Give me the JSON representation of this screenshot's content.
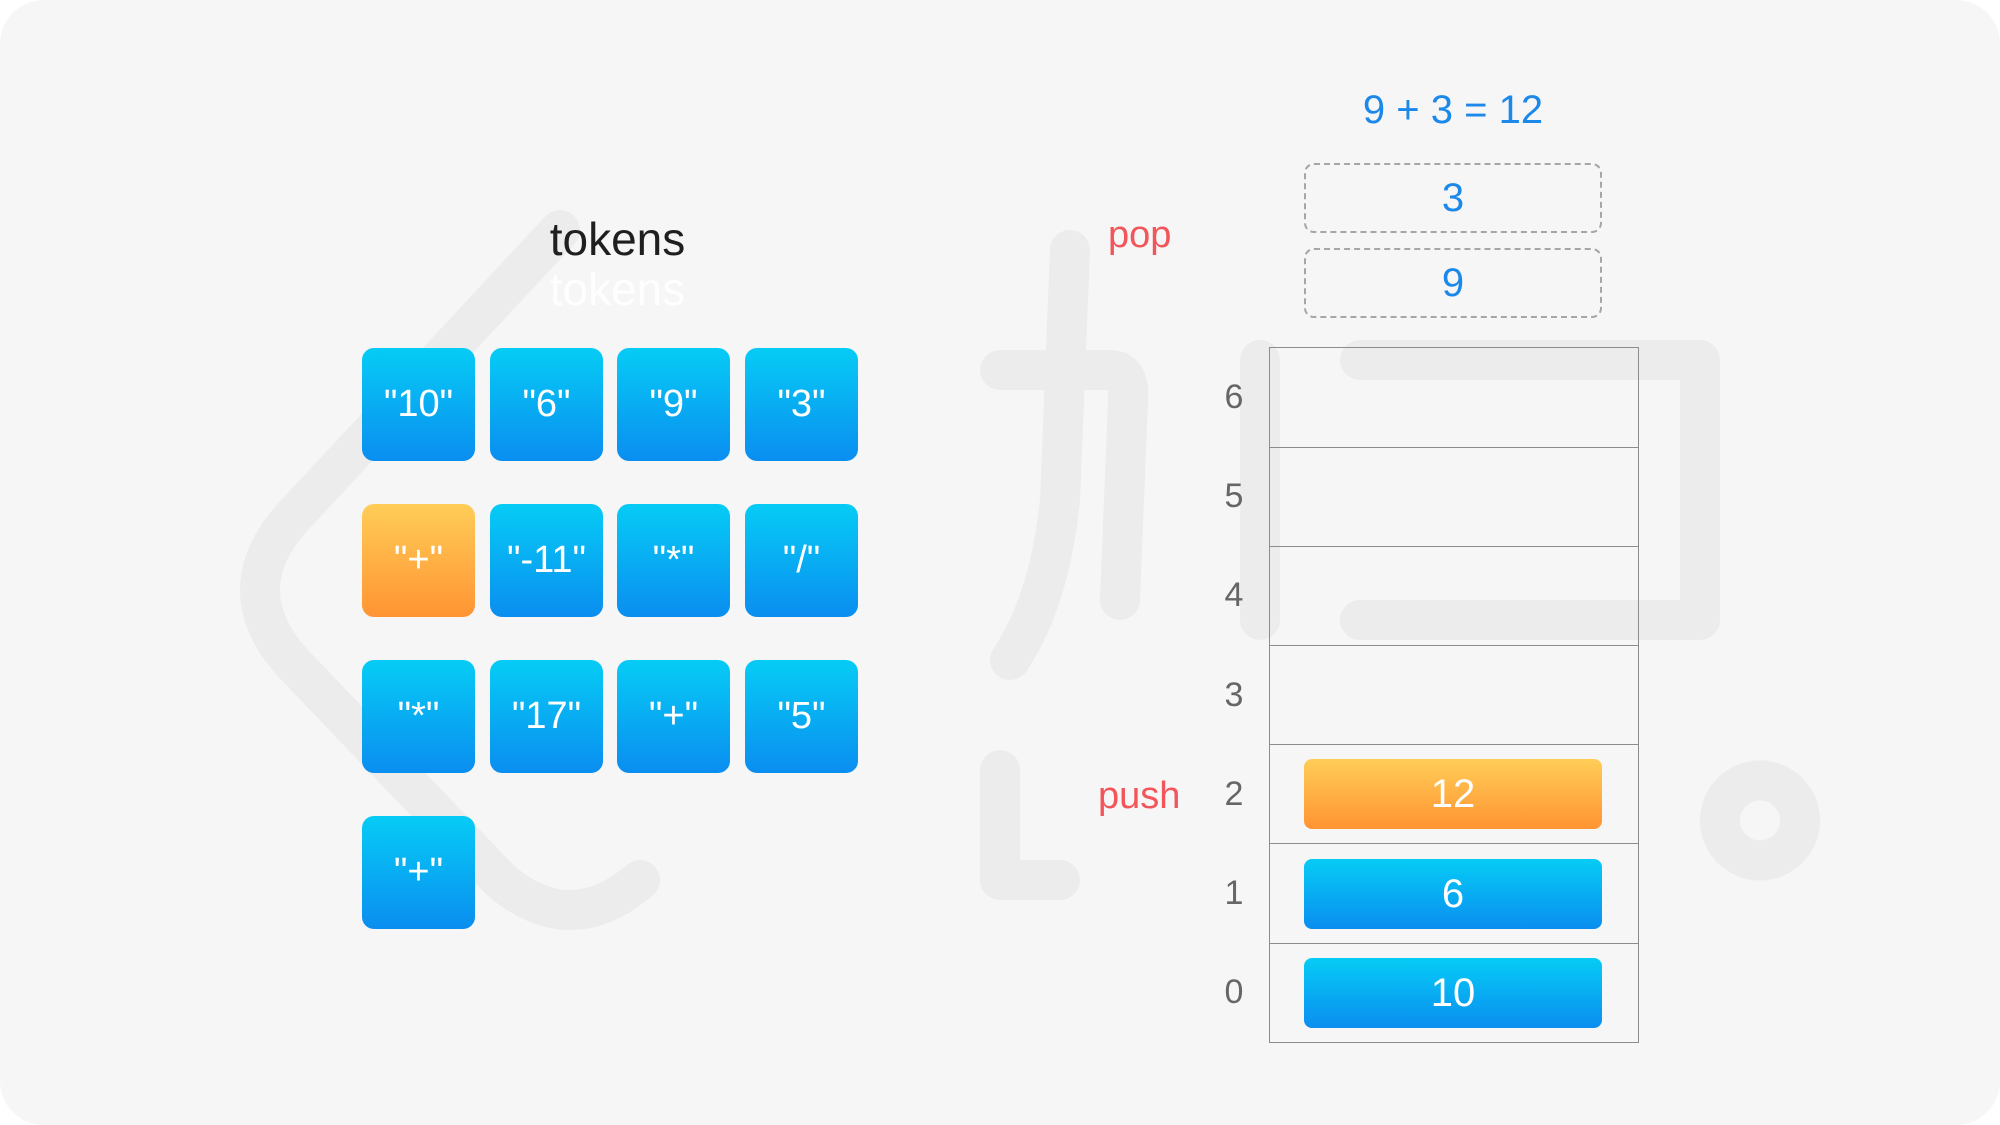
{
  "tokens_title": "tokens",
  "tokens": [
    "\"10\"",
    "\"6\"",
    "\"9\"",
    "\"3\"",
    "\"+\"",
    "\"-11\"",
    "\"*\"",
    "\"/\"",
    "\"*\"",
    "\"17\"",
    "\"+\"",
    "\"5\"",
    "\"+\""
  ],
  "active_token_index": 4,
  "equation": "9 + 3 = 12",
  "pop_label": "pop",
  "push_label": "push",
  "popped": [
    "3",
    "9"
  ],
  "stack_indices": [
    "6",
    "5",
    "4",
    "3",
    "2",
    "1",
    "0"
  ],
  "stack_items": [
    "10",
    "6",
    "12"
  ],
  "active_stack_index": 2,
  "colors": {
    "token_blue": "#0a8ef0",
    "highlight_orange": "#ff9433",
    "label_red": "#f2555a",
    "equation_blue": "#1b88ea"
  }
}
